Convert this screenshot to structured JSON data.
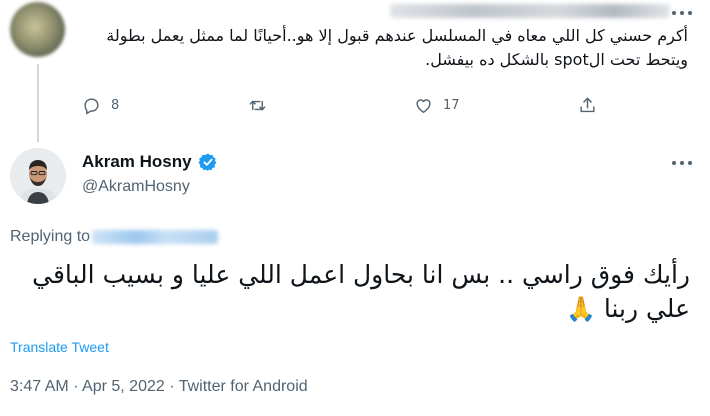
{
  "parent_tweet": {
    "text": "أكرم حسني كل اللي معاه في المسلسل عندهم قبول إلا هو..أحيانًا لما ممثل يعمل بطولة ويتحط تحت الspot بالشكل ده بيفشل.",
    "replies": "8",
    "retweets": "",
    "likes": "17"
  },
  "main_tweet": {
    "author_name": "Akram Hosny",
    "author_handle": "@AkramHosny",
    "replying_to_label": "Replying to",
    "text": "رأيك فوق راسي .. بس انا بحاول اعمل اللي عليا و بسيب الباقي علي ربنا",
    "emoji": "🙏",
    "translate_label": "Translate Tweet",
    "meta": "3:47 AM · Apr 5, 2022 · Twitter for Android"
  },
  "colors": {
    "link": "#1d9bf0",
    "secondary_text": "#536471",
    "verified": "#1d9bf0",
    "thread_line": "#cfd9de"
  },
  "icons": {
    "reply": "speech-bubble-icon",
    "retweet": "retweet-arrows-icon",
    "like": "heart-outline-icon",
    "share": "share-upload-icon",
    "more": "more-horizontal-icon",
    "verified": "verified-badge-icon"
  }
}
